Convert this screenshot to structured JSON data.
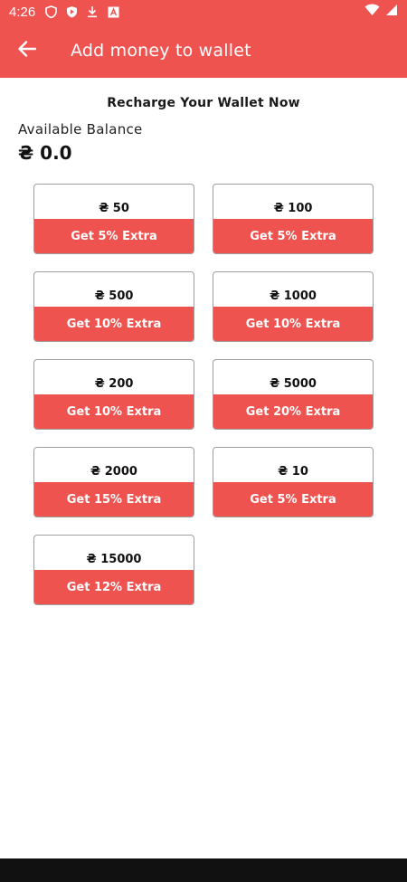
{
  "status": {
    "time": "4:26",
    "icons": [
      "shield-icon",
      "play-protect-icon",
      "download-icon",
      "font-icon"
    ],
    "right_icons": [
      "wifi-icon",
      "signal-icon"
    ]
  },
  "app_bar": {
    "title": "Add money to wallet",
    "back_icon": "arrow-left-icon",
    "color": "#ef5350"
  },
  "heading": "Recharge Your Wallet Now",
  "balance": {
    "label": "Available Balance",
    "value": "₴ 0.0"
  },
  "offers": [
    {
      "amount": "₴ 50",
      "extra": "Get 5% Extra"
    },
    {
      "amount": "₴ 100",
      "extra": "Get 5% Extra"
    },
    {
      "amount": "₴ 500",
      "extra": "Get 10% Extra"
    },
    {
      "amount": "₴ 1000",
      "extra": "Get 10% Extra"
    },
    {
      "amount": "₴ 200",
      "extra": "Get 10% Extra"
    },
    {
      "amount": "₴ 5000",
      "extra": "Get 20% Extra"
    },
    {
      "amount": "₴ 2000",
      "extra": "Get 15% Extra"
    },
    {
      "amount": "₴ 10",
      "extra": "Get 5% Extra"
    },
    {
      "amount": "₴ 15000",
      "extra": "Get 12% Extra"
    }
  ]
}
